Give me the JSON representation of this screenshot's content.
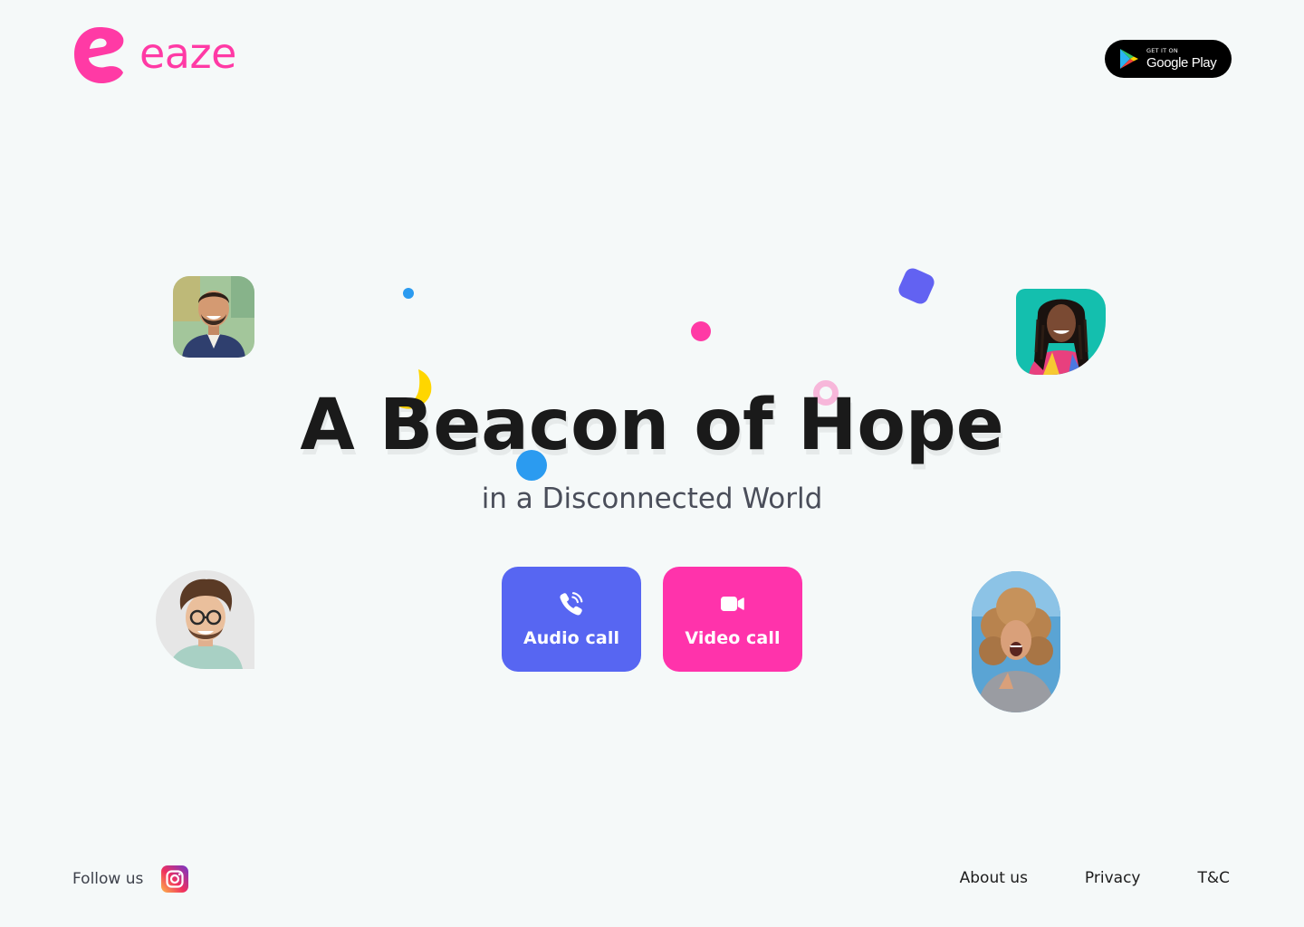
{
  "brand": {
    "name": "eaze",
    "color": "#ff3aa5"
  },
  "store_badge": {
    "small_text": "GET IT ON",
    "big_text": "Google Play",
    "icon": "google-play-icon"
  },
  "hero": {
    "title": "A Beacon of Hope",
    "subtitle": "in a Disconnected World"
  },
  "actions": {
    "audio": {
      "label": "Audio call",
      "icon": "phone-icon",
      "color": "#5766f2"
    },
    "video": {
      "label": "Video call",
      "icon": "video-camera-icon",
      "color": "#ff33ab"
    }
  },
  "avatars": [
    {
      "icon": "avatar-man-suit",
      "background": "#9bc19a"
    },
    {
      "icon": "avatar-woman-braids",
      "background": "#1bbfae"
    },
    {
      "icon": "avatar-man-glasses",
      "background": "#e8e8e8"
    },
    {
      "icon": "avatar-woman-curly-hair",
      "background": "#5ea8d6"
    }
  ],
  "decorations": {
    "colors": [
      "#2b9bf0",
      "#ff3aa5",
      "#6262f2",
      "#f7b7da",
      "#ffd600"
    ]
  },
  "footer": {
    "follow_label": "Follow us",
    "social_icon": "instagram-icon",
    "links": [
      "About us",
      "Privacy",
      "T&C"
    ]
  }
}
